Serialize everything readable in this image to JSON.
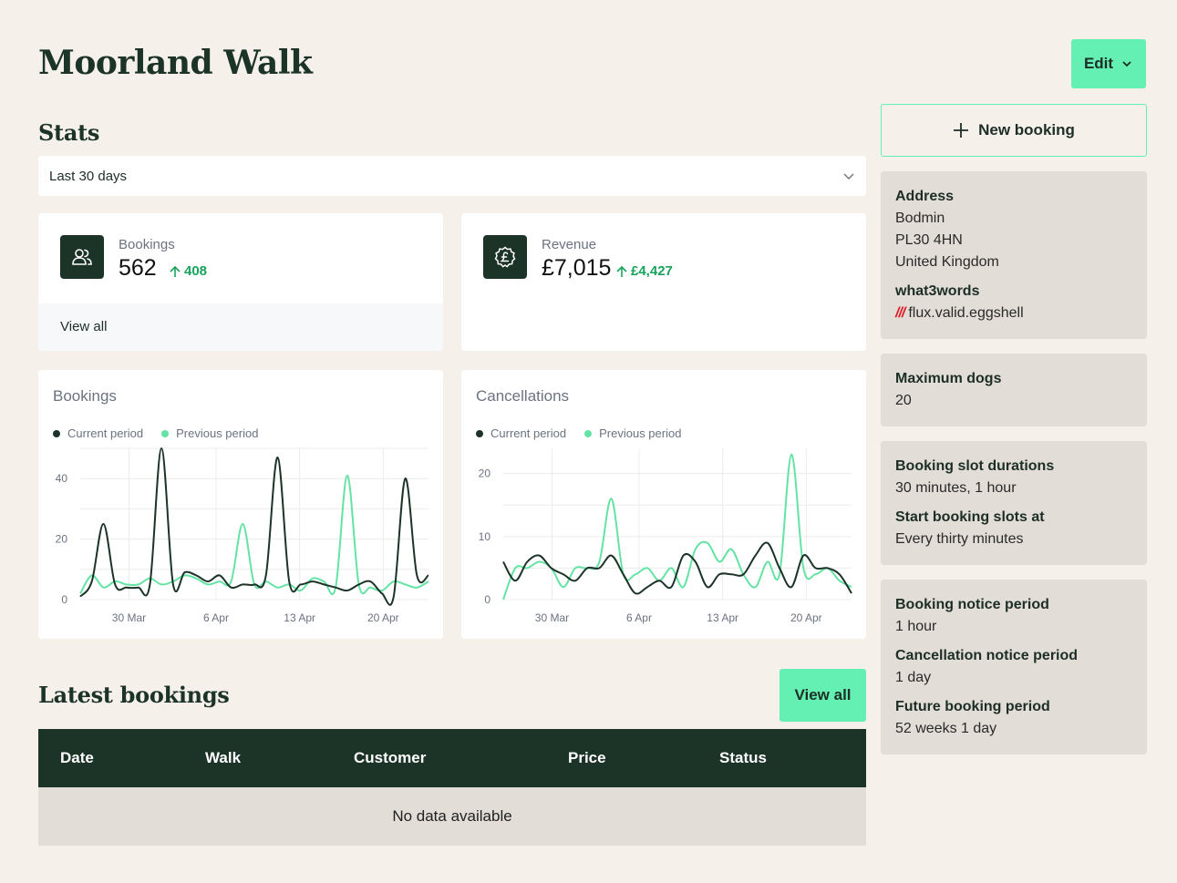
{
  "page": {
    "title": "Moorland Walk",
    "edit_label": "Edit"
  },
  "stats": {
    "title": "Stats",
    "period": "Last 30 days",
    "bookings": {
      "label": "Bookings",
      "value": "562",
      "delta": "408",
      "footer": "View all"
    },
    "revenue": {
      "label": "Revenue",
      "value": "£7,015",
      "delta": "£4,427"
    }
  },
  "colors": {
    "accent": "#65f0b3",
    "dark": "#1c3328",
    "background": "#f5f0ea",
    "panel": "#e2ddd6",
    "delta": "#18a35a",
    "w3w": "#e11d2a"
  },
  "icons": {
    "bookings": "users-icon",
    "revenue": "pound-badge-icon",
    "edit": "chevron-down-icon",
    "select": "chevron-down-icon",
    "new_booking": "plus-icon",
    "delta": "arrow-up-icon"
  },
  "chart_data": [
    {
      "type": "line",
      "title": "Bookings",
      "x_ticks": [
        "30 Mar",
        "6 Apr",
        "13 Apr",
        "20 Apr"
      ],
      "ylim": [
        0,
        50
      ],
      "y_ticks": [
        0,
        20,
        40
      ],
      "grid": true,
      "legend": "top-left",
      "series": [
        {
          "name": "Current period",
          "color": "#1c3328",
          "values": [
            1,
            6,
            25,
            5,
            4,
            4,
            5,
            50,
            5,
            9,
            8,
            6,
            8,
            4,
            5,
            5,
            8,
            47,
            6,
            5,
            6,
            5,
            4,
            3,
            5,
            6,
            2,
            1,
            40,
            8,
            8
          ]
        },
        {
          "name": "Previous period",
          "color": "#65e3a4",
          "values": [
            2,
            8,
            4,
            6,
            5,
            5,
            7,
            5,
            6,
            8,
            7,
            5,
            6,
            6,
            25,
            5,
            6,
            4,
            5,
            3,
            7,
            6,
            4,
            41,
            5,
            4,
            3,
            6,
            5,
            4,
            6
          ]
        }
      ]
    },
    {
      "type": "line",
      "title": "Cancellations",
      "x_ticks": [
        "30 Mar",
        "6 Apr",
        "13 Apr",
        "20 Apr"
      ],
      "ylim": [
        0,
        24
      ],
      "y_ticks": [
        0,
        10,
        20
      ],
      "grid": true,
      "legend": "top-left",
      "series": [
        {
          "name": "Current period",
          "color": "#1c3328",
          "values": [
            6,
            3,
            6,
            7,
            5,
            4,
            3,
            5,
            5,
            7,
            4,
            1,
            2,
            3,
            2,
            7,
            6,
            2,
            4,
            4,
            4,
            7,
            9,
            5,
            2,
            7,
            5,
            5,
            4,
            1
          ]
        },
        {
          "name": "Previous period",
          "color": "#65e3a4",
          "values": [
            0,
            5,
            5,
            6,
            5,
            2,
            5,
            5,
            6,
            16,
            4,
            4,
            5,
            3,
            5,
            2,
            8,
            9,
            6,
            8,
            4,
            2,
            6,
            4,
            23,
            5,
            4,
            5,
            3,
            2
          ]
        }
      ]
    }
  ],
  "sidebar": {
    "new_booking_label": "New booking",
    "address": {
      "label": "Address",
      "lines": [
        "Bodmin",
        "PL30 4HN",
        "United Kingdom"
      ]
    },
    "what3words": {
      "label": "what3words",
      "slashes": "///",
      "value": "flux.valid.eggshell"
    },
    "max_dogs": {
      "label": "Maximum dogs",
      "value": "20"
    },
    "slot_durations": {
      "label": "Booking slot durations",
      "value": "30 minutes, 1 hour"
    },
    "slot_start": {
      "label": "Start booking slots at",
      "value": "Every thirty minutes"
    },
    "notice": {
      "label": "Booking notice period",
      "value": "1 hour"
    },
    "cancellation": {
      "label": "Cancellation notice period",
      "value": "1 day"
    },
    "future": {
      "label": "Future booking period",
      "value": "52 weeks 1 day"
    }
  },
  "latest": {
    "title": "Latest bookings",
    "view_all": "View all",
    "columns": [
      "Date",
      "Walk",
      "Customer",
      "Price",
      "Status"
    ],
    "empty": "No data available"
  }
}
